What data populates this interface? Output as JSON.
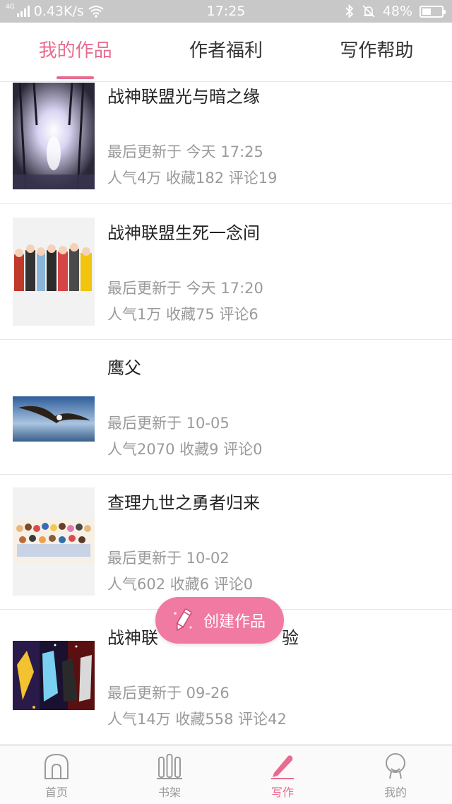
{
  "status_bar": {
    "network": "0.43K/s",
    "network_tag": "4G",
    "time": "17:25",
    "battery": "48%",
    "battery_level": 0.48
  },
  "tabs": [
    {
      "label": "我的作品",
      "active": true
    },
    {
      "label": "作者福利",
      "active": false
    },
    {
      "label": "写作帮助",
      "active": false
    }
  ],
  "works": [
    {
      "title": "战神联盟光与暗之缘",
      "updated": "最后更新于 今天 17:25",
      "stats": "人气4万  收藏182  评论19"
    },
    {
      "title": "战神联盟生死一念间",
      "updated": "最后更新于 今天 17:20",
      "stats": "人气1万  收藏75  评论6"
    },
    {
      "title": "鹰父",
      "updated": "最后更新于 10-05",
      "stats": "人气2070  收藏9  评论0"
    },
    {
      "title": "查理九世之勇者归来",
      "updated": "最后更新于 10-02",
      "stats": "人气602  收藏6  评论0"
    },
    {
      "title": "战神联",
      "title_tail": "验",
      "updated": "最后更新于 09-26",
      "stats": "人气14万  收藏558  评论42"
    }
  ],
  "fab": {
    "label": "创建作品"
  },
  "bottom_nav": [
    {
      "label": "首页",
      "icon": "home-icon",
      "active": false
    },
    {
      "label": "书架",
      "icon": "bookshelf-icon",
      "active": false
    },
    {
      "label": "写作",
      "icon": "pen-icon",
      "active": true
    },
    {
      "label": "我的",
      "icon": "profile-icon",
      "active": false
    }
  ],
  "colors": {
    "accent": "#e86c8f",
    "fab": "#f07aa1",
    "meta_text": "#9a9a9a"
  }
}
